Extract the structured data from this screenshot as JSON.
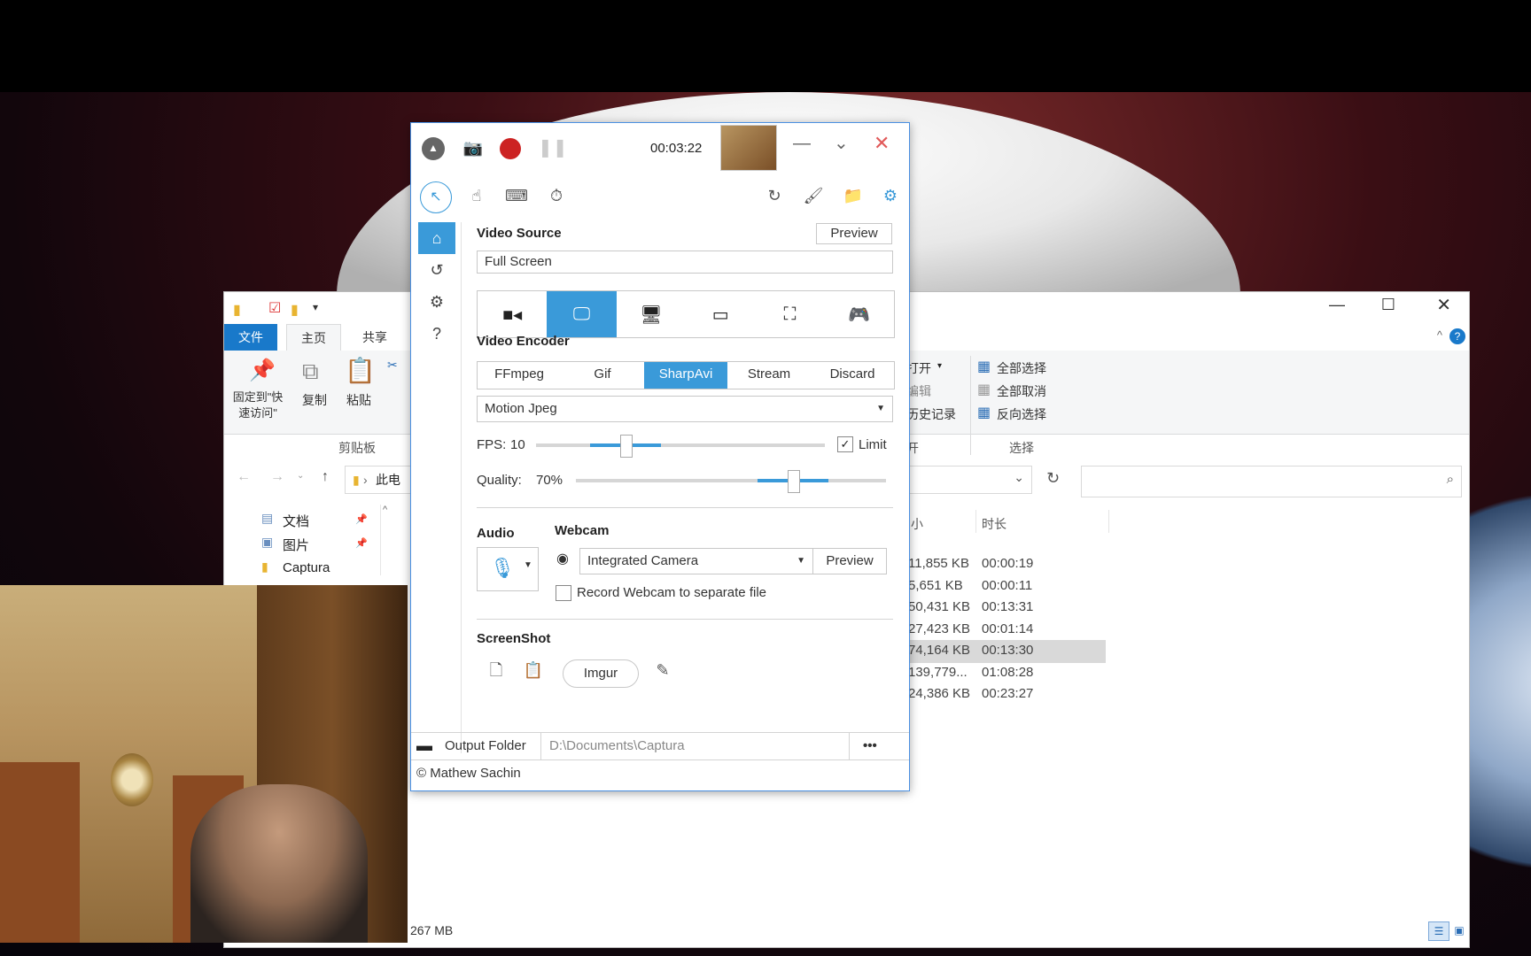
{
  "explorer": {
    "tabs": {
      "file": "文件",
      "home": "主页",
      "share": "共享"
    },
    "ribbon": {
      "pin": "固定到\"快速访问\"",
      "copy": "复制",
      "paste": "粘贴",
      "clipboard_group": "剪贴板",
      "open": "打开",
      "edit": "编辑",
      "history": "历史记录",
      "open_group_tail": "开",
      "select_all": "全部选择",
      "select_none": "全部取消",
      "invert_select": "反向选择",
      "select_group": "选择"
    },
    "address_crumb": "此电",
    "nav_items": [
      "文档",
      "图片",
      "Captura"
    ],
    "columns": {
      "size": "小",
      "duration": "时长"
    },
    "rows": [
      {
        "size": "11,855 KB",
        "duration": "00:00:19"
      },
      {
        "size": "5,651 KB",
        "duration": "00:00:11"
      },
      {
        "size": "50,431 KB",
        "duration": "00:13:31"
      },
      {
        "size": "27,423 KB",
        "duration": "00:01:14"
      },
      {
        "size": "74,164 KB",
        "duration": "00:13:30"
      },
      {
        "size": "139,779...",
        "duration": "01:08:28"
      },
      {
        "size": "24,386 KB",
        "duration": "00:23:27"
      }
    ],
    "status_text": "267 MB"
  },
  "captura": {
    "timer": "00:03:22",
    "video_source": {
      "title": "Video Source",
      "preview_label": "Preview",
      "selected": "Full Screen"
    },
    "video_encoder": {
      "title": "Video Encoder",
      "options": [
        "FFmpeg",
        "Gif",
        "SharpAvi",
        "Stream",
        "Discard"
      ],
      "active": "SharpAvi",
      "codec": "Motion Jpeg"
    },
    "fps": {
      "label": "FPS:",
      "value": "10",
      "limit_label": "Limit",
      "limit_checked": true,
      "level": 0.31
    },
    "quality": {
      "label": "Quality:",
      "value": "70%",
      "level": 0.7
    },
    "audio": {
      "title": "Audio"
    },
    "webcam": {
      "title": "Webcam",
      "device": "Integrated Camera",
      "preview_label": "Preview",
      "separate_label": "Record Webcam to separate file",
      "separate_checked": false
    },
    "screenshot": {
      "title": "ScreenShot",
      "imgur_label": "Imgur"
    },
    "output": {
      "label": "Output Folder",
      "path": "D:\\Documents\\Captura",
      "more": "•••"
    },
    "footer": "© Mathew Sachin",
    "accent": "#3a9ad9",
    "record_color": "#cc2222"
  }
}
